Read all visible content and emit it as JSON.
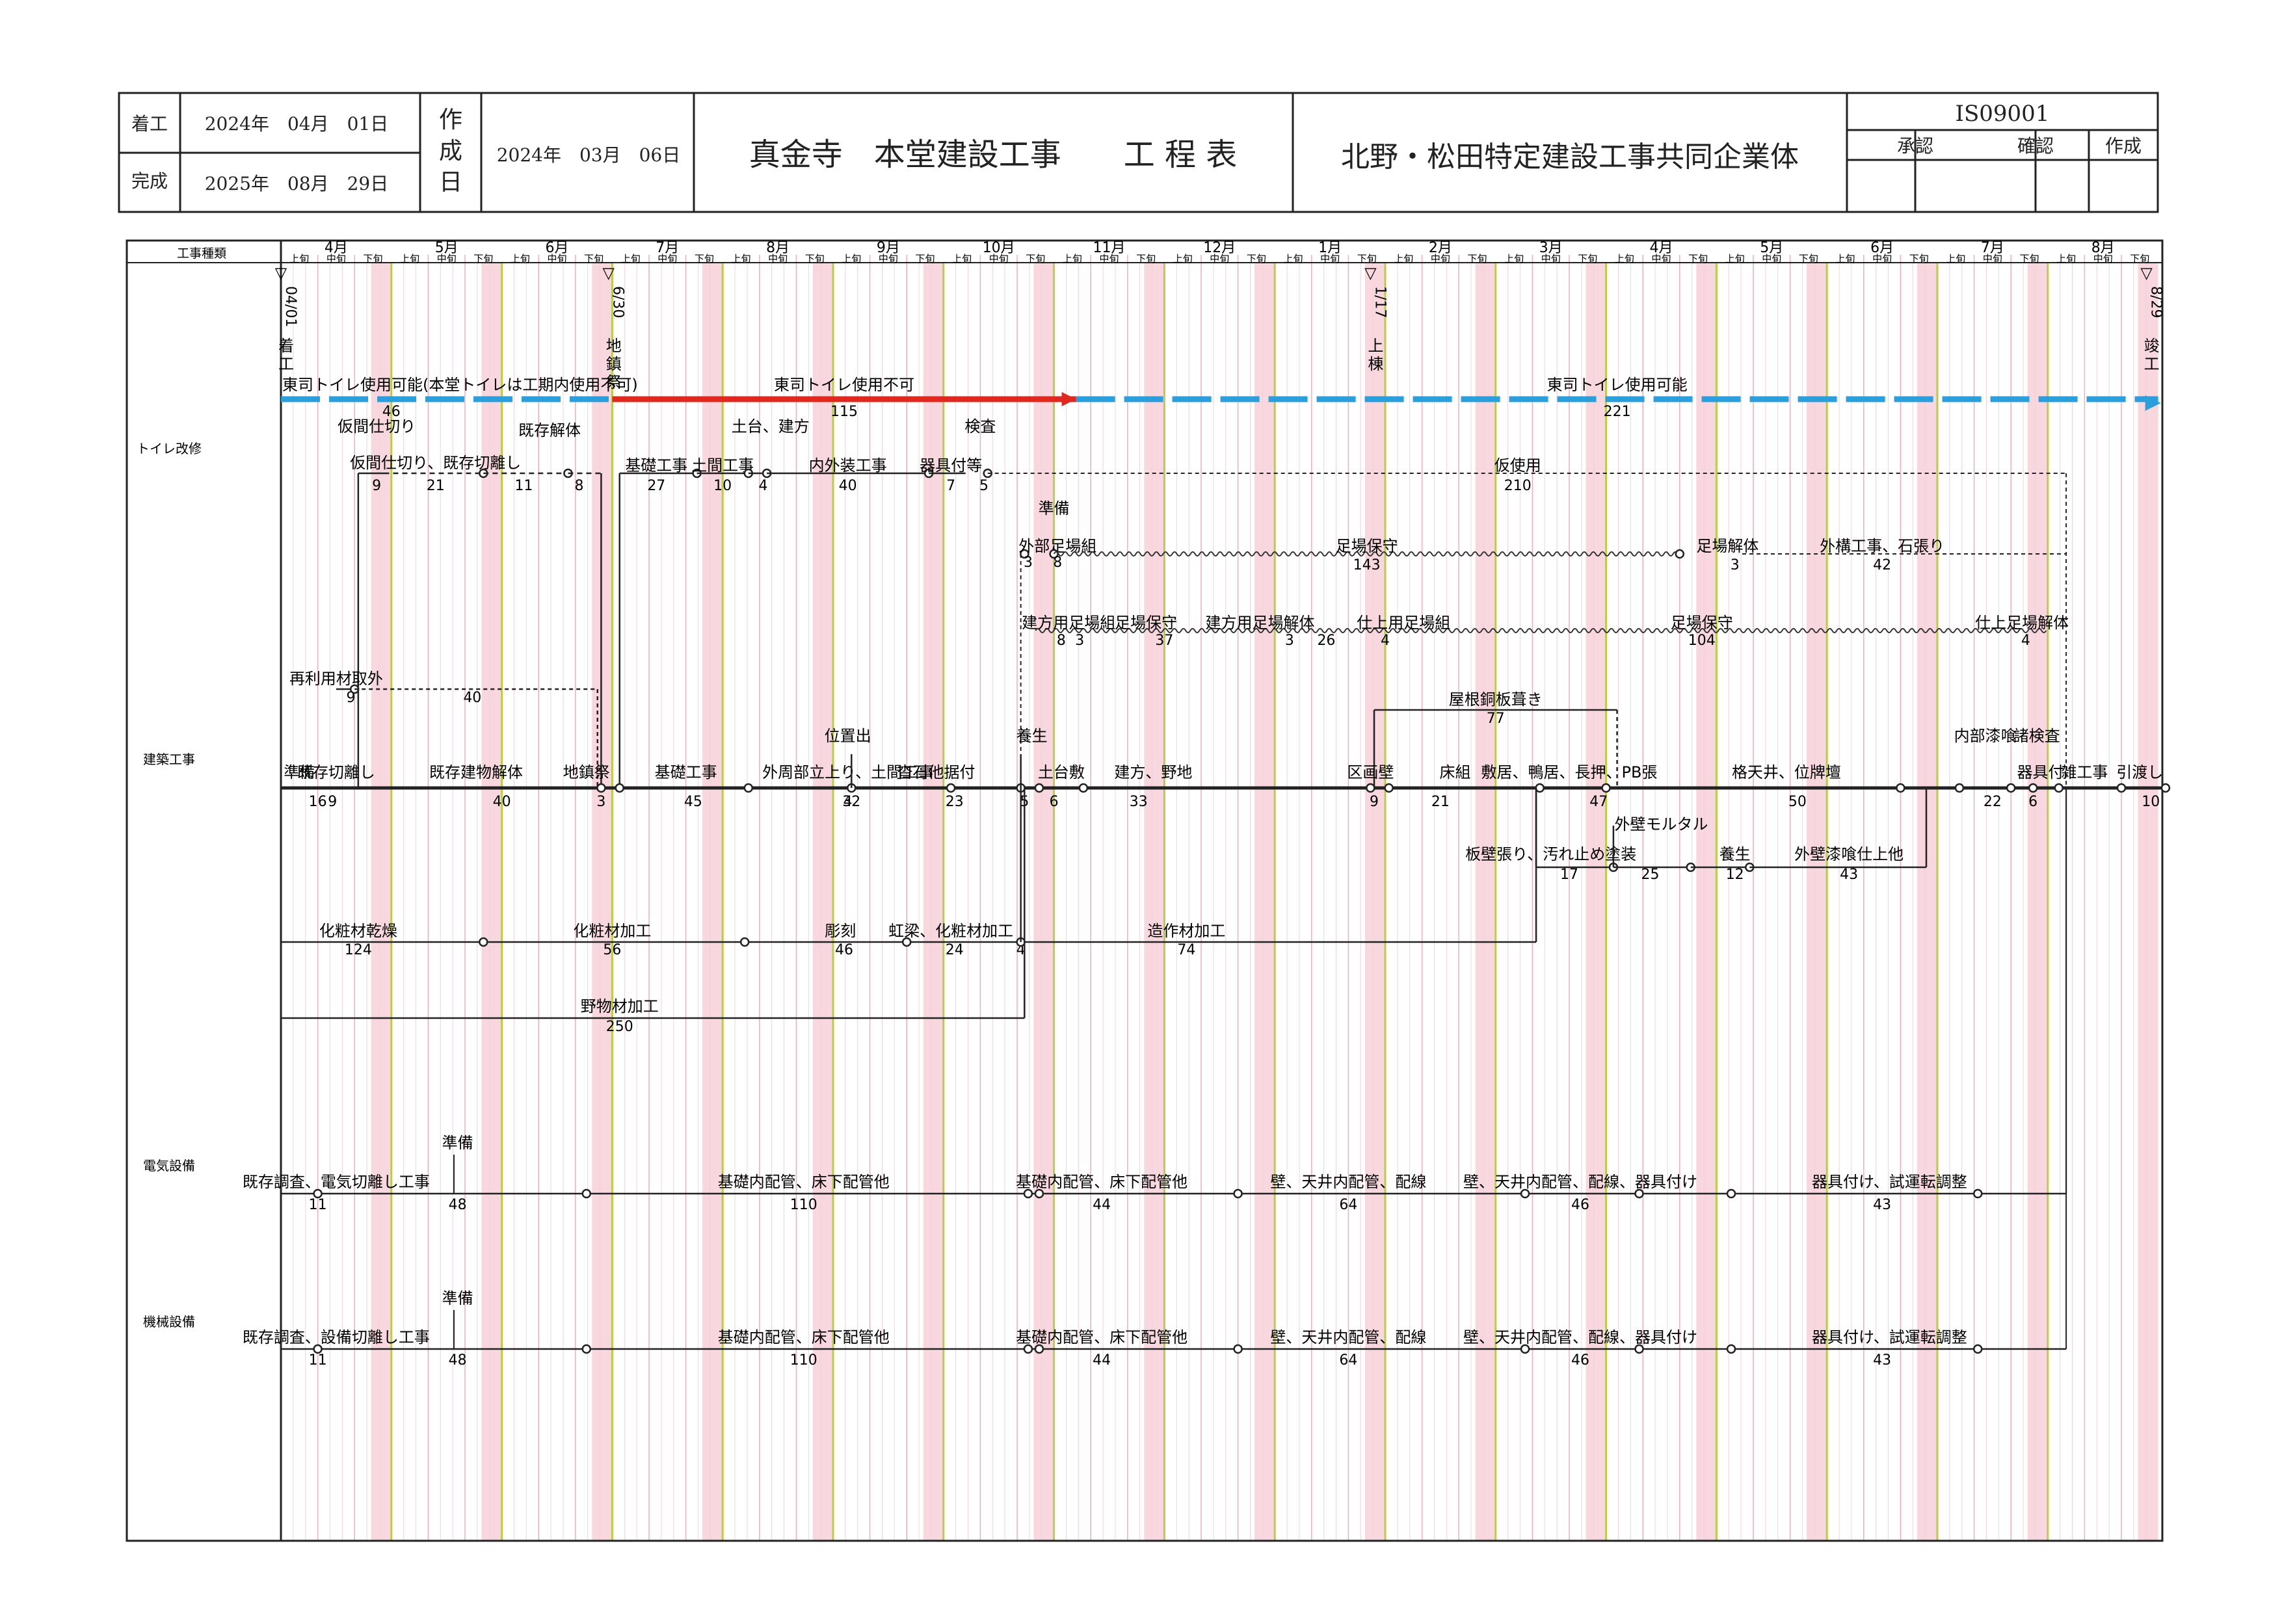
{
  "header": {
    "start_label": "着工",
    "start_date": "2024年　04月　01日",
    "end_label": "完成",
    "end_date": "2025年　08月　29日",
    "created_label": "作成日",
    "created_date": "2024年　03月　06日",
    "title": "真金寺　本堂建設工事　　工 程 表",
    "company": "北野・松田特定建設工事共同企業体",
    "iso": "IS09001",
    "approvals": [
      "承認",
      "確認",
      "作成"
    ]
  },
  "grid": {
    "type_label": "工事種類",
    "months": [
      "4月",
      "5月",
      "6月",
      "7月",
      "8月",
      "9月",
      "10月",
      "11月",
      "12月",
      "1月",
      "2月",
      "3月",
      "4月",
      "5月",
      "6月",
      "7月",
      "8月"
    ],
    "decades": [
      "上旬",
      "中旬",
      "下旬"
    ]
  },
  "sections": [
    "トイレ改修",
    "建築工事",
    "電気設備",
    "機械設備"
  ],
  "milestones": [
    {
      "date": "04/01",
      "label": "着工",
      "dec": 0
    },
    {
      "date": "6/30",
      "label": "地鎮祭",
      "dec": 8.9
    },
    {
      "date": "1/17",
      "label": "上棟",
      "dec": 29.6
    },
    {
      "date": "8/29",
      "label": "竣工",
      "dec": 51
    }
  ],
  "toilet": {
    "notices": [
      {
        "label": "東司トイレ使用可能(本堂トイレは工期内使用不可)",
        "days": "46",
        "color": "#2a9fdc"
      },
      {
        "label": "東司トイレ使用不可",
        "days": "115",
        "color": "#e0281e"
      },
      {
        "label": "東司トイレ使用可能",
        "days": "221",
        "color": "#2a9fdc"
      }
    ],
    "tasks": [
      {
        "label": "仮間仕切り",
        "days": "9"
      },
      {
        "label": "仮間仕切り、既存切離し",
        "days": "21"
      },
      {
        "label": "",
        "days": "11"
      },
      {
        "label": "既存解体",
        "days": "8"
      },
      {
        "label": "基礎工事",
        "days": "27"
      },
      {
        "label": "土間工事",
        "days": "10"
      },
      {
        "label": "土台、建方",
        "days": "4"
      },
      {
        "label": "内外装工事",
        "days": "40"
      },
      {
        "label": "器具付等",
        "days": "7"
      },
      {
        "label": "検査",
        "days": "5"
      },
      {
        "label": "仮使用",
        "days": "210"
      }
    ]
  },
  "building": {
    "scaffold_row1": [
      {
        "label": "準備",
        "days": "3"
      },
      {
        "label": "外部足場組",
        "days": "8"
      },
      {
        "label": "足場保守",
        "days": "143"
      },
      {
        "label": "足場解体",
        "days": "3"
      },
      {
        "label": "外構工事、石張り",
        "days": "42"
      }
    ],
    "scaffold_row2": [
      {
        "label": "建方用足場組",
        "days": "8"
      },
      {
        "label": "",
        "days": "3"
      },
      {
        "label": "足場保守",
        "days": "37"
      },
      {
        "label": "建方用足場解体",
        "days": "3"
      },
      {
        "label": "",
        "days": "26"
      },
      {
        "label": "仕上用足場組",
        "days": "4"
      },
      {
        "label": "足場保守",
        "days": "104"
      },
      {
        "label": "仕上足場解体",
        "days": "4"
      }
    ],
    "reuse": [
      {
        "label": "再利用材取外",
        "days": "9"
      },
      {
        "label": "",
        "days": "40"
      }
    ],
    "roof": {
      "label": "屋根銅板葺き",
      "days": "77"
    },
    "main": [
      {
        "label": "準備",
        "days": "16"
      },
      {
        "label": "既存切離し",
        "days": "9"
      },
      {
        "label": "既存建物解体",
        "days": "40"
      },
      {
        "label": "地鎮祭",
        "days": "3"
      },
      {
        "label": "基礎工事",
        "days": "45"
      },
      {
        "label": "外周部立上り、土間工事",
        "days": "32"
      },
      {
        "label": "位置出",
        "days": "4"
      },
      {
        "label": "沓石他据付",
        "days": "23"
      },
      {
        "label": "養生",
        "days": "5"
      },
      {
        "label": "土台敷",
        "days": "6"
      },
      {
        "label": "建方、野地",
        "days": "33"
      },
      {
        "label": "区画壁",
        "days": "9"
      },
      {
        "label": "床組",
        "days": "21"
      },
      {
        "label": "敷居、鴨居、長押、PB張",
        "days": "47"
      },
      {
        "label": "格天井、位牌壇",
        "days": "50"
      },
      {
        "label": "内部漆喰",
        "days": "22"
      },
      {
        "label": "器具付",
        "days": "6"
      },
      {
        "label": "諸検査",
        "days": ""
      },
      {
        "label": "雑工事",
        "days": ""
      },
      {
        "label": "引渡し",
        "days": "10"
      }
    ],
    "lower": [
      {
        "label": "板壁張り、汚れ止め塗装",
        "days": "17"
      },
      {
        "label": "外壁モルタル",
        "days": "25"
      },
      {
        "label": "養生",
        "days": "12"
      },
      {
        "label": "外壁漆喰仕上他",
        "days": "43"
      }
    ],
    "materials": [
      {
        "label": "化粧材乾燥",
        "days": "124"
      },
      {
        "label": "化粧材加工",
        "days": "56"
      },
      {
        "label": "彫刻",
        "days": "46"
      },
      {
        "label": "虹梁、化粧材加工",
        "days": "24"
      },
      {
        "label": "",
        "days": "4"
      },
      {
        "label": "造作材加工",
        "days": "74"
      }
    ],
    "rough": {
      "label": "野物材加工",
      "days": "250"
    }
  },
  "electrical": [
    {
      "label": "既存調査、電気切離し工事",
      "days": "11"
    },
    {
      "label": "準備",
      "days": "48"
    },
    {
      "label": "基礎内配管、床下配管他",
      "days": "110"
    },
    {
      "label": "基礎内配管、床下配管他",
      "days": "44"
    },
    {
      "label": "壁、天井内配管、配線",
      "days": "64"
    },
    {
      "label": "壁、天井内配管、配線、器具付け",
      "days": "46"
    },
    {
      "label": "器具付け、試運転調整",
      "days": "43"
    }
  ],
  "mechanical": [
    {
      "label": "既存調査、設備切離し工事",
      "days": "11"
    },
    {
      "label": "準備",
      "days": "48"
    },
    {
      "label": "基礎内配管、床下配管他",
      "days": "110"
    },
    {
      "label": "基礎内配管、床下配管他",
      "days": "44"
    },
    {
      "label": "壁、天井内配管、配線",
      "days": "64"
    },
    {
      "label": "壁、天井内配管、配線、器具付け",
      "days": "46"
    },
    {
      "label": "器具付け、試運転調整",
      "days": "43"
    }
  ]
}
